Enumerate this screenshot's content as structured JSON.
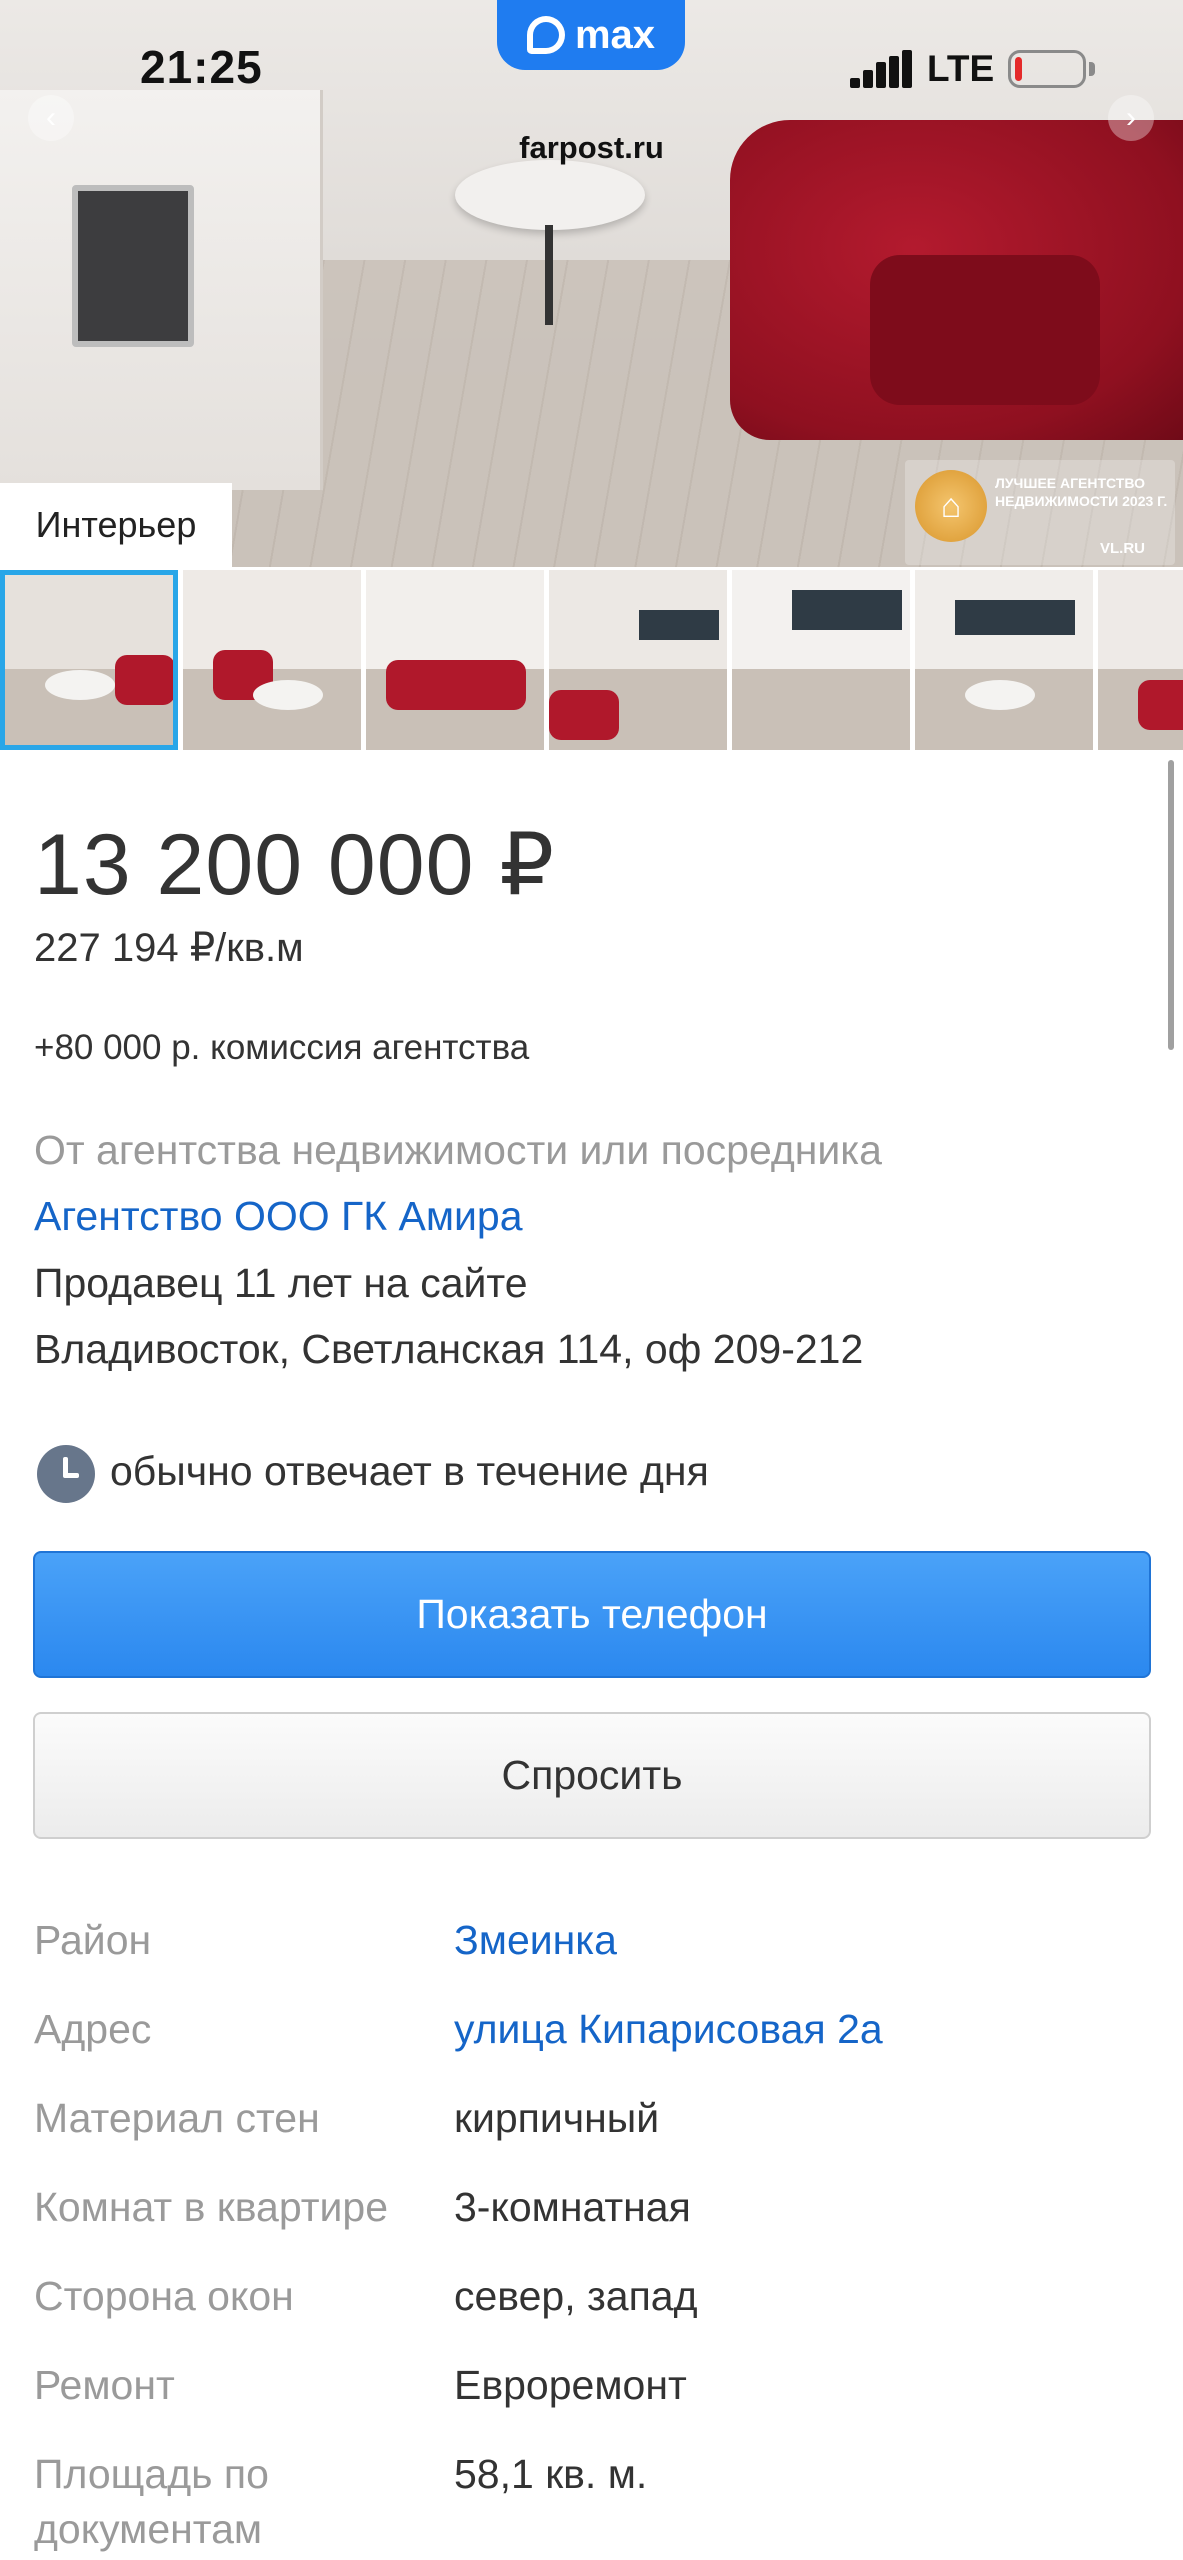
{
  "status_bar": {
    "time": "21:25",
    "network": "LTE",
    "app_pill": "max",
    "url": "farpost.ru",
    "battery_level": 0.1,
    "battery_color": "#e42a2a"
  },
  "gallery": {
    "photo_label": "Интерьер",
    "badge_text": "Лучшее агентство недвижимости 2023 г.",
    "badge_site": "VL.RU",
    "thumbnail_count": 7,
    "active_thumbnail": 1
  },
  "listing": {
    "price": "13 200 000 ₽",
    "price_per_m2": "227 194 ₽/кв.м",
    "commission": "+80 000 р. комиссия агентства",
    "seller_type": "От агентства недвижимости или посредника",
    "agency_name": "Агентство ООО ГК Амира",
    "seller_tenure": "Продавец 11 лет на сайте",
    "seller_address": "Владивосток, Светланская 114, оф 209-212",
    "reply_time": "обычно отвечает в течение дня"
  },
  "buttons": {
    "show_phone": "Показать телефон",
    "ask": "Спросить"
  },
  "properties": [
    {
      "label": "Район",
      "value": "Змеинка",
      "link": true
    },
    {
      "label": "Адрес",
      "value": "улица Кипарисовая 2а",
      "link": true
    },
    {
      "label": "Материал стен",
      "value": "кирпичный",
      "link": false
    },
    {
      "label": "Комнат в квартире",
      "value": "3-комнатная",
      "link": false
    },
    {
      "label": "Сторона окон",
      "value": "север, запад",
      "link": false
    },
    {
      "label": "Ремонт",
      "value": "Евроремонт",
      "link": false
    },
    {
      "label": "Площадь по документам",
      "value": "58,1 кв. м.",
      "link": false
    }
  ],
  "colors": {
    "link": "#1565c8",
    "primary_button": "#2b88ef",
    "muted_text": "#9a9a9a",
    "active_thumb_border": "#29a6e8",
    "app_pill": "#1f7cf0"
  }
}
